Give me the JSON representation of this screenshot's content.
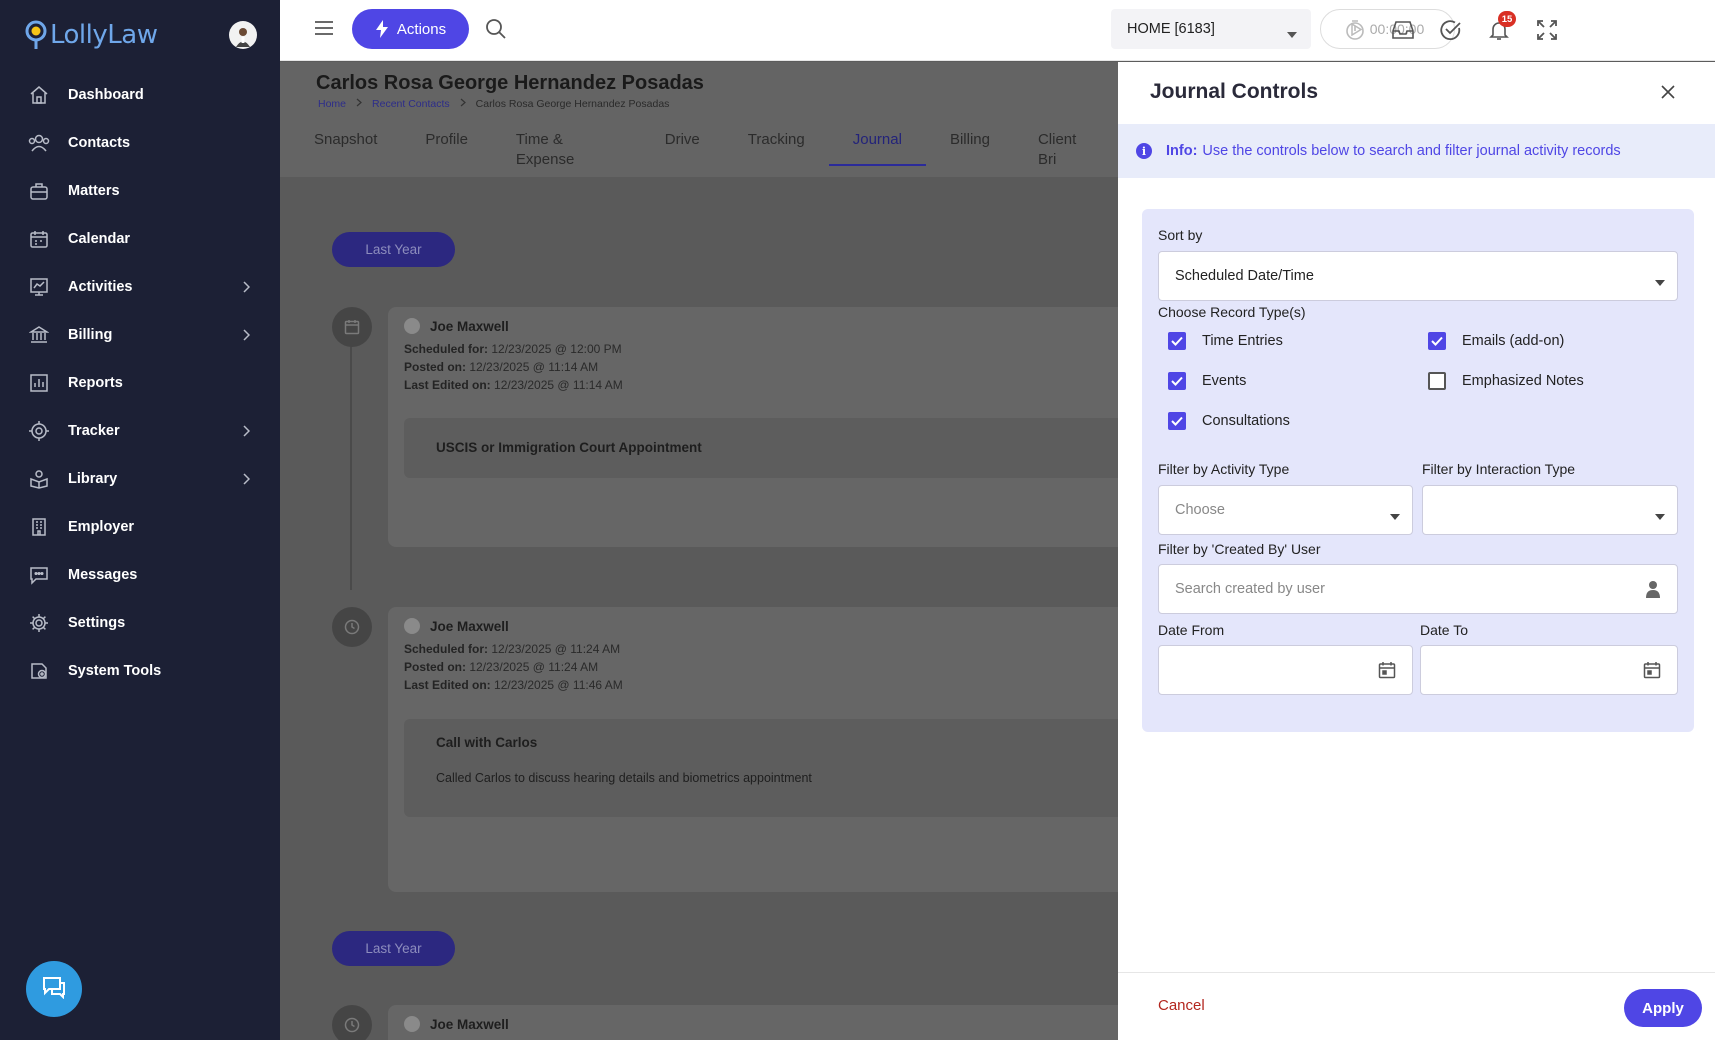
{
  "app": {
    "logo_text": "LollyLaw"
  },
  "sidebar": {
    "items": [
      {
        "label": "Dashboard",
        "icon": "home-icon",
        "has_submenu": false
      },
      {
        "label": "Contacts",
        "icon": "contacts-icon",
        "has_submenu": false
      },
      {
        "label": "Matters",
        "icon": "briefcase-icon",
        "has_submenu": false
      },
      {
        "label": "Calendar",
        "icon": "calendar-icon",
        "has_submenu": false
      },
      {
        "label": "Activities",
        "icon": "activity-chart-icon",
        "has_submenu": true
      },
      {
        "label": "Billing",
        "icon": "bank-icon",
        "has_submenu": true
      },
      {
        "label": "Reports",
        "icon": "bar-chart-icon",
        "has_submenu": false
      },
      {
        "label": "Tracker",
        "icon": "target-icon",
        "has_submenu": true
      },
      {
        "label": "Library",
        "icon": "library-icon",
        "has_submenu": true
      },
      {
        "label": "Employer",
        "icon": "building-icon",
        "has_submenu": false
      },
      {
        "label": "Messages",
        "icon": "message-icon",
        "has_submenu": false
      },
      {
        "label": "Settings",
        "icon": "gear-icon",
        "has_submenu": false
      },
      {
        "label": "System Tools",
        "icon": "system-tools-icon",
        "has_submenu": false
      }
    ]
  },
  "topbar": {
    "actions_label": "Actions",
    "home_select": "HOME [6183]",
    "timer": "00:00:00",
    "notification_count": "15"
  },
  "page": {
    "title": "Carlos Rosa George Hernandez Posadas",
    "breadcrumb": [
      "Home",
      "Recent Contacts",
      "Carlos Rosa George Hernandez Posadas"
    ],
    "tabs": [
      "Snapshot",
      "Profile",
      "Time & Expense",
      "Drive",
      "Tracking",
      "Journal",
      "Billing",
      "Client Bri"
    ],
    "active_tab": "Journal"
  },
  "journal": {
    "group_label_1": "Last Year",
    "group_label_2": "Last Year",
    "entries": [
      {
        "author": "Joe Maxwell",
        "scheduled_label": "Scheduled for:",
        "scheduled": "12/23/2025 @ 12:00 PM",
        "posted_label": "Posted on:",
        "posted": "12/23/2025 @ 11:14 AM",
        "edited_label": "Last Edited on:",
        "edited": "12/23/2025 @ 11:14 AM",
        "title": "USCIS or Immigration Court Appointment"
      },
      {
        "author": "Joe Maxwell",
        "scheduled_label": "Scheduled for:",
        "scheduled": "12/23/2025 @ 11:24 AM",
        "posted_label": "Posted on:",
        "posted": "12/23/2025 @ 11:24 AM",
        "edited_label": "Last Edited on:",
        "edited": "12/23/2025 @ 11:46 AM",
        "title": "Call with Carlos",
        "description": "Called Carlos to discuss hearing details and biometrics appointment"
      },
      {
        "author": "Joe Maxwell"
      }
    ]
  },
  "panel": {
    "title": "Journal Controls",
    "info_label": "Info:",
    "info_text": "Use the controls below to search and filter journal activity records",
    "sort_label": "Sort by",
    "sort_value": "Scheduled Date/Time",
    "record_types_label": "Choose Record Type(s)",
    "record_types": [
      {
        "label": "Time Entries",
        "checked": true
      },
      {
        "label": "Emails (add-on)",
        "checked": true
      },
      {
        "label": "Events",
        "checked": true
      },
      {
        "label": "Emphasized Notes",
        "checked": false
      },
      {
        "label": "Consultations",
        "checked": true
      }
    ],
    "activity_type_label": "Filter by Activity Type",
    "activity_type_placeholder": "Choose",
    "interaction_type_label": "Filter by Interaction Type",
    "interaction_type_value": "",
    "created_by_label": "Filter by 'Created By' User",
    "created_by_placeholder": "Search created by user",
    "date_from_label": "Date From",
    "date_to_label": "Date To",
    "cancel_label": "Cancel",
    "apply_label": "Apply"
  },
  "colors": {
    "sidebar_bg": "#1c2035",
    "accent": "#4f46e5",
    "cancel": "#b3261e",
    "badge": "#d93025"
  }
}
